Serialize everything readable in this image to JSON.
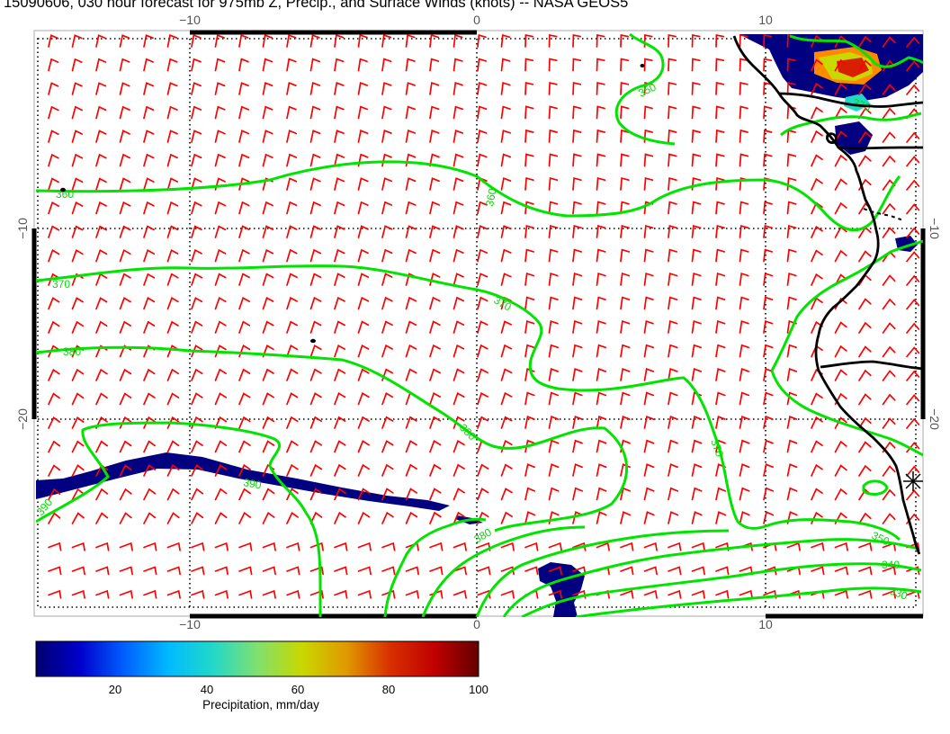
{
  "title": "15090606, 030 hour forecast for 975mb Z, Precip., and Surface Winds (knots) -- NASA GEOS5",
  "map": {
    "lon_range": [
      -15,
      15
    ],
    "lat_range": [
      -30,
      0
    ],
    "top_axis_labels": [
      "−10",
      "0",
      "10"
    ],
    "bottom_axis_labels": [
      "−10",
      "0",
      "10"
    ],
    "left_axis_labels": [
      "−10",
      "−20"
    ],
    "right_axis_labels": [
      "−10",
      "−20"
    ],
    "gridlines": "dotted",
    "coastline_color": "#000000",
    "wind_barb_color": "#ff0000",
    "contour_color": "#00ee00",
    "precip_color": "#000080",
    "contour_labels": [
      "360",
      "360",
      "350",
      "370",
      "370",
      "380",
      "380",
      "370",
      "380",
      "390",
      "390",
      "370",
      "350",
      "340",
      "330"
    ]
  },
  "colorbar": {
    "ticks": [
      "20",
      "40",
      "60",
      "80",
      "100"
    ],
    "label": "Precipitation, mm/day",
    "colors": [
      "#00006e",
      "#0000cc",
      "#0060ff",
      "#00bbff",
      "#22d8c8",
      "#80e070",
      "#c8d800",
      "#e09a00",
      "#d83000",
      "#c00000",
      "#640000"
    ]
  }
}
